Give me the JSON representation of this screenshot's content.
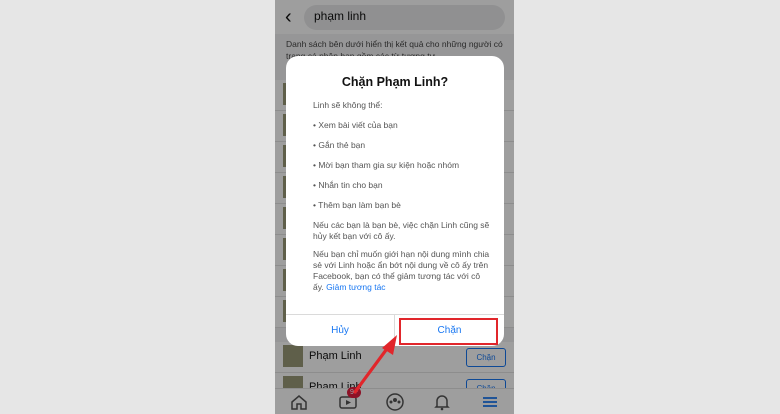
{
  "search": {
    "back_icon": "chevron-left-icon",
    "query": "phạm linh"
  },
  "description": "Danh sách bên dưới hiển thị kết quả cho những người có trang cá nhân bạn gồm các từ tương tự",
  "results": [
    {
      "name": "Phạm Linh",
      "button": "Chặn"
    },
    {
      "name": "Phạm Linh",
      "button": "Chặn"
    }
  ],
  "tabs": [
    {
      "icon": "home-icon"
    },
    {
      "icon": "watch-icon",
      "badge": "9+"
    },
    {
      "icon": "groups-icon"
    },
    {
      "icon": "bell-icon"
    },
    {
      "icon": "menu-icon"
    }
  ],
  "dialog": {
    "title": "Chặn Phạm Linh?",
    "intro": "Linh sẽ không thể:",
    "items": [
      "• Xem bài viết của bạn",
      "• Gắn thẻ bạn",
      "• Mời bạn tham gia sự kiện hoặc nhóm",
      "• Nhắn tin cho bạn",
      "• Thêm bạn làm bạn bè"
    ],
    "note1": "Nếu các bạn là bạn bè, việc chặn Linh cũng sẽ hủy kết bạn với cô ấy.",
    "note2_text": "Nếu bạn chỉ muốn giới hạn nội dung mình chia sẻ với Linh hoặc ẩn bớt nội dung về cô ấy trên Facebook, bạn có thể giảm tương tác với cô ấy.",
    "note2_link": "Giảm tương tác",
    "cancel": "Hủy",
    "confirm": "Chặn"
  },
  "colors": {
    "accent": "#1877f2",
    "highlight": "#e1262b"
  }
}
